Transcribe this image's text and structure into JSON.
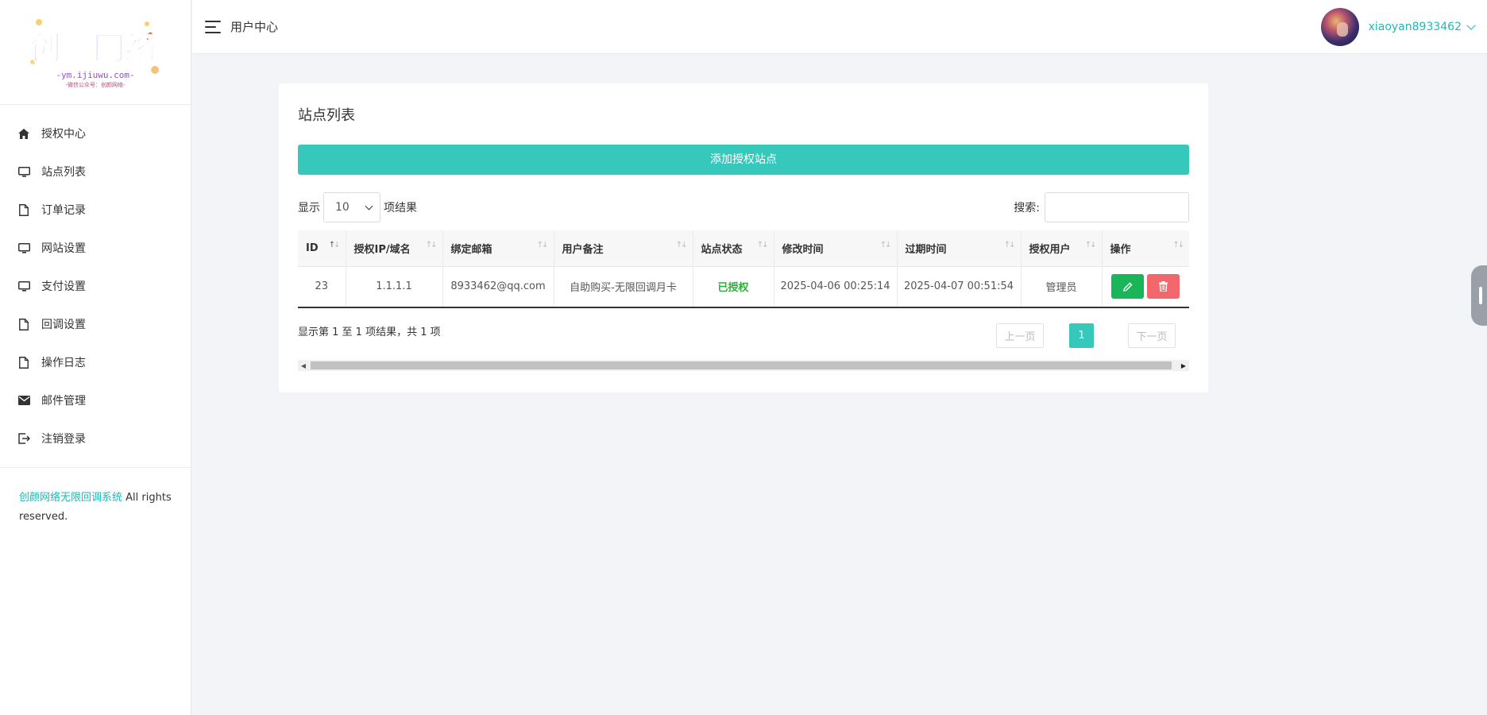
{
  "sidebar": {
    "logo": {
      "title": "创颜网络",
      "line1": "-ym.ijiuwu.com-",
      "line2": "-微信公众号：创颜网络-"
    },
    "items": [
      {
        "label": "授权中心",
        "icon": "home-icon"
      },
      {
        "label": "站点列表",
        "icon": "monitor-icon"
      },
      {
        "label": "订单记录",
        "icon": "file-icon"
      },
      {
        "label": "网站设置",
        "icon": "monitor-icon"
      },
      {
        "label": "支付设置",
        "icon": "monitor-icon"
      },
      {
        "label": "回调设置",
        "icon": "file-icon"
      },
      {
        "label": "操作日志",
        "icon": "file-icon"
      },
      {
        "label": "邮件管理",
        "icon": "mail-icon"
      },
      {
        "label": "注销登录",
        "icon": "logout-icon"
      }
    ],
    "footer": {
      "link": "创颜网络无限回调系统",
      "text": " All rights reserved."
    }
  },
  "header": {
    "title": "用户中心",
    "username": "xiaoyan8933462"
  },
  "main": {
    "card_title": "站点列表",
    "add_button": "添加授权站点",
    "length_prefix": "显示",
    "length_value": "10",
    "length_suffix": "项结果",
    "search_label": "搜索:",
    "search_value": "",
    "columns": [
      "ID",
      "授权IP/域名",
      "绑定邮箱",
      "用户备注",
      "站点状态",
      "修改时间",
      "过期时间",
      "授权用户",
      "操作"
    ],
    "rows": [
      {
        "id": "23",
        "domain": "1.1.1.1",
        "email": "8933462@qq.com",
        "note": "自助购买-无限回调月卡",
        "status": "已授权",
        "modified": "2025-04-06 00:25:14",
        "expires": "2025-04-07 00:51:54",
        "user": "管理员"
      }
    ],
    "info": "显示第 1 至 1 项结果，共 1 项",
    "pagination": {
      "prev": "上一页",
      "current": "1",
      "next": "下一页"
    }
  },
  "colors": {
    "accent": "#36c9bb",
    "link": "#1cbbb4",
    "status_ok": "#2bae3a",
    "edit": "#1bb559",
    "delete": "#f1676c"
  }
}
